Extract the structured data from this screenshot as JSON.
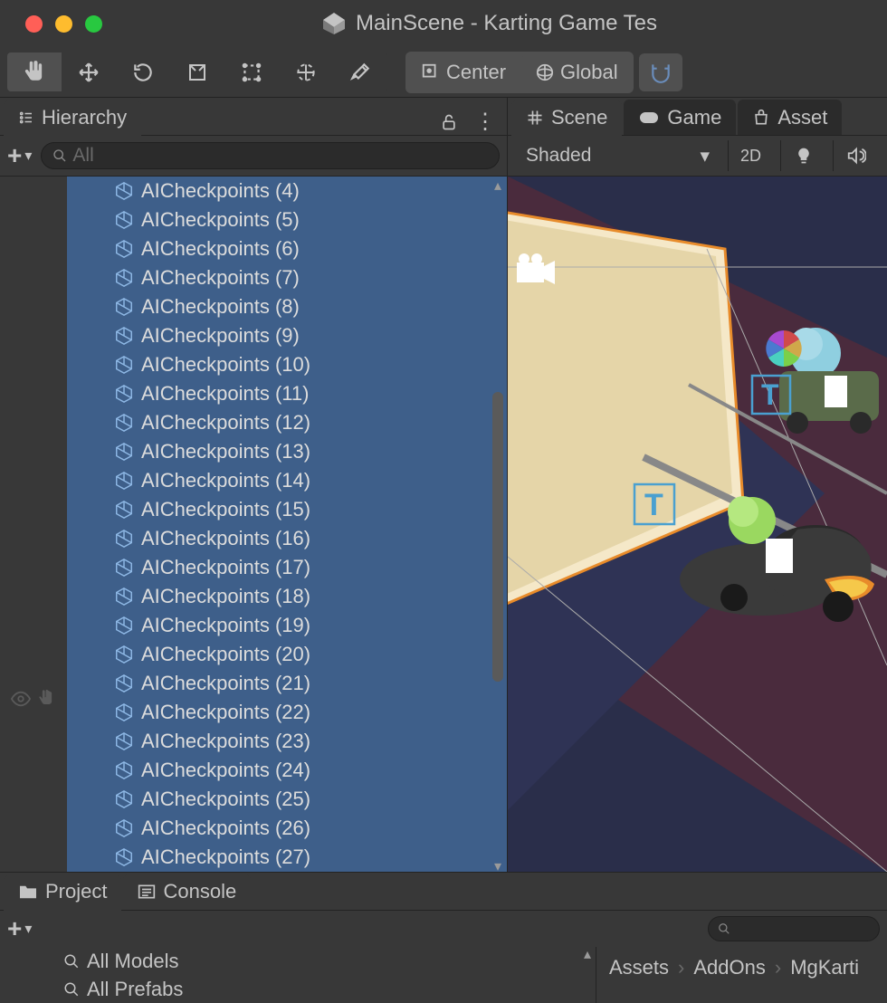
{
  "window": {
    "title": "MainScene - Karting Game Tes"
  },
  "toolbar": {
    "pivot_label": "Center",
    "space_label": "Global"
  },
  "hierarchy": {
    "tab_label": "Hierarchy",
    "search_placeholder": "All",
    "items": [
      "AICheckpoints (4)",
      "AICheckpoints (5)",
      "AICheckpoints (6)",
      "AICheckpoints (7)",
      "AICheckpoints (8)",
      "AICheckpoints (9)",
      "AICheckpoints (10)",
      "AICheckpoints (11)",
      "AICheckpoints (12)",
      "AICheckpoints (13)",
      "AICheckpoints (14)",
      "AICheckpoints (15)",
      "AICheckpoints (16)",
      "AICheckpoints (17)",
      "AICheckpoints (18)",
      "AICheckpoints (19)",
      "AICheckpoints (20)",
      "AICheckpoints (21)",
      "AICheckpoints (22)",
      "AICheckpoints (23)",
      "AICheckpoints (24)",
      "AICheckpoints (25)",
      "AICheckpoints (26)",
      "AICheckpoints (27)"
    ]
  },
  "scene": {
    "tabs": {
      "scene": "Scene",
      "game": "Game",
      "asset": "Asset"
    },
    "shading_mode": "Shaded",
    "view_2d": "2D"
  },
  "bottom": {
    "project_tab": "Project",
    "console_tab": "Console",
    "all_models": "All Models",
    "all_prefabs": "All Prefabs",
    "breadcrumb": [
      "Assets",
      "AddOns",
      "MgKarti"
    ]
  }
}
